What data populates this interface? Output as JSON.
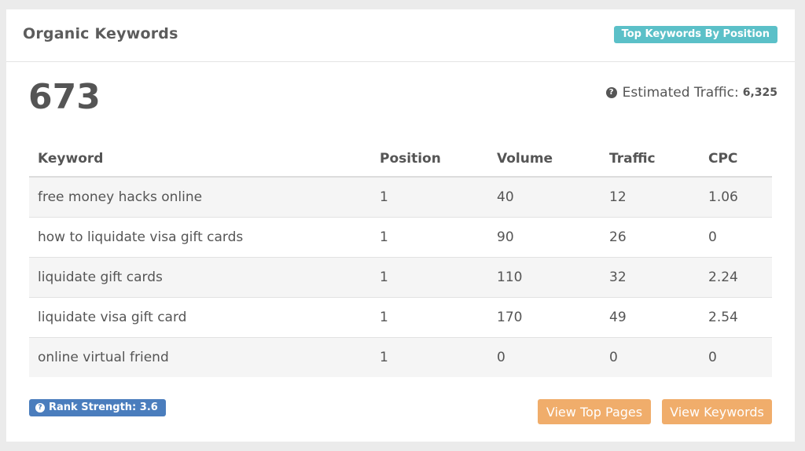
{
  "header": {
    "title": "Organic Keywords",
    "badge": "Top Keywords By Position"
  },
  "summary": {
    "total": "673",
    "traffic_label": "Estimated Traffic:",
    "traffic_value": "6,325",
    "help_icon": "question-circle-icon"
  },
  "table": {
    "columns": [
      "Keyword",
      "Position",
      "Volume",
      "Traffic",
      "CPC"
    ],
    "rows": [
      [
        "free money hacks online",
        "1",
        "40",
        "12",
        "1.06"
      ],
      [
        "how to liquidate visa gift cards",
        "1",
        "90",
        "26",
        "0"
      ],
      [
        "liquidate gift cards",
        "1",
        "110",
        "32",
        "2.24"
      ],
      [
        "liquidate visa gift card",
        "1",
        "170",
        "49",
        "2.54"
      ],
      [
        "online virtual friend",
        "1",
        "0",
        "0",
        "0"
      ]
    ]
  },
  "footer": {
    "rank_strength": "Rank Strength: 3.6",
    "view_top_pages": "View Top Pages",
    "view_keywords": "View Keywords"
  },
  "colors": {
    "teal_badge": "#5bc0c8",
    "blue_badge": "#4a7dbd",
    "orange_button": "#f0ad6b"
  }
}
